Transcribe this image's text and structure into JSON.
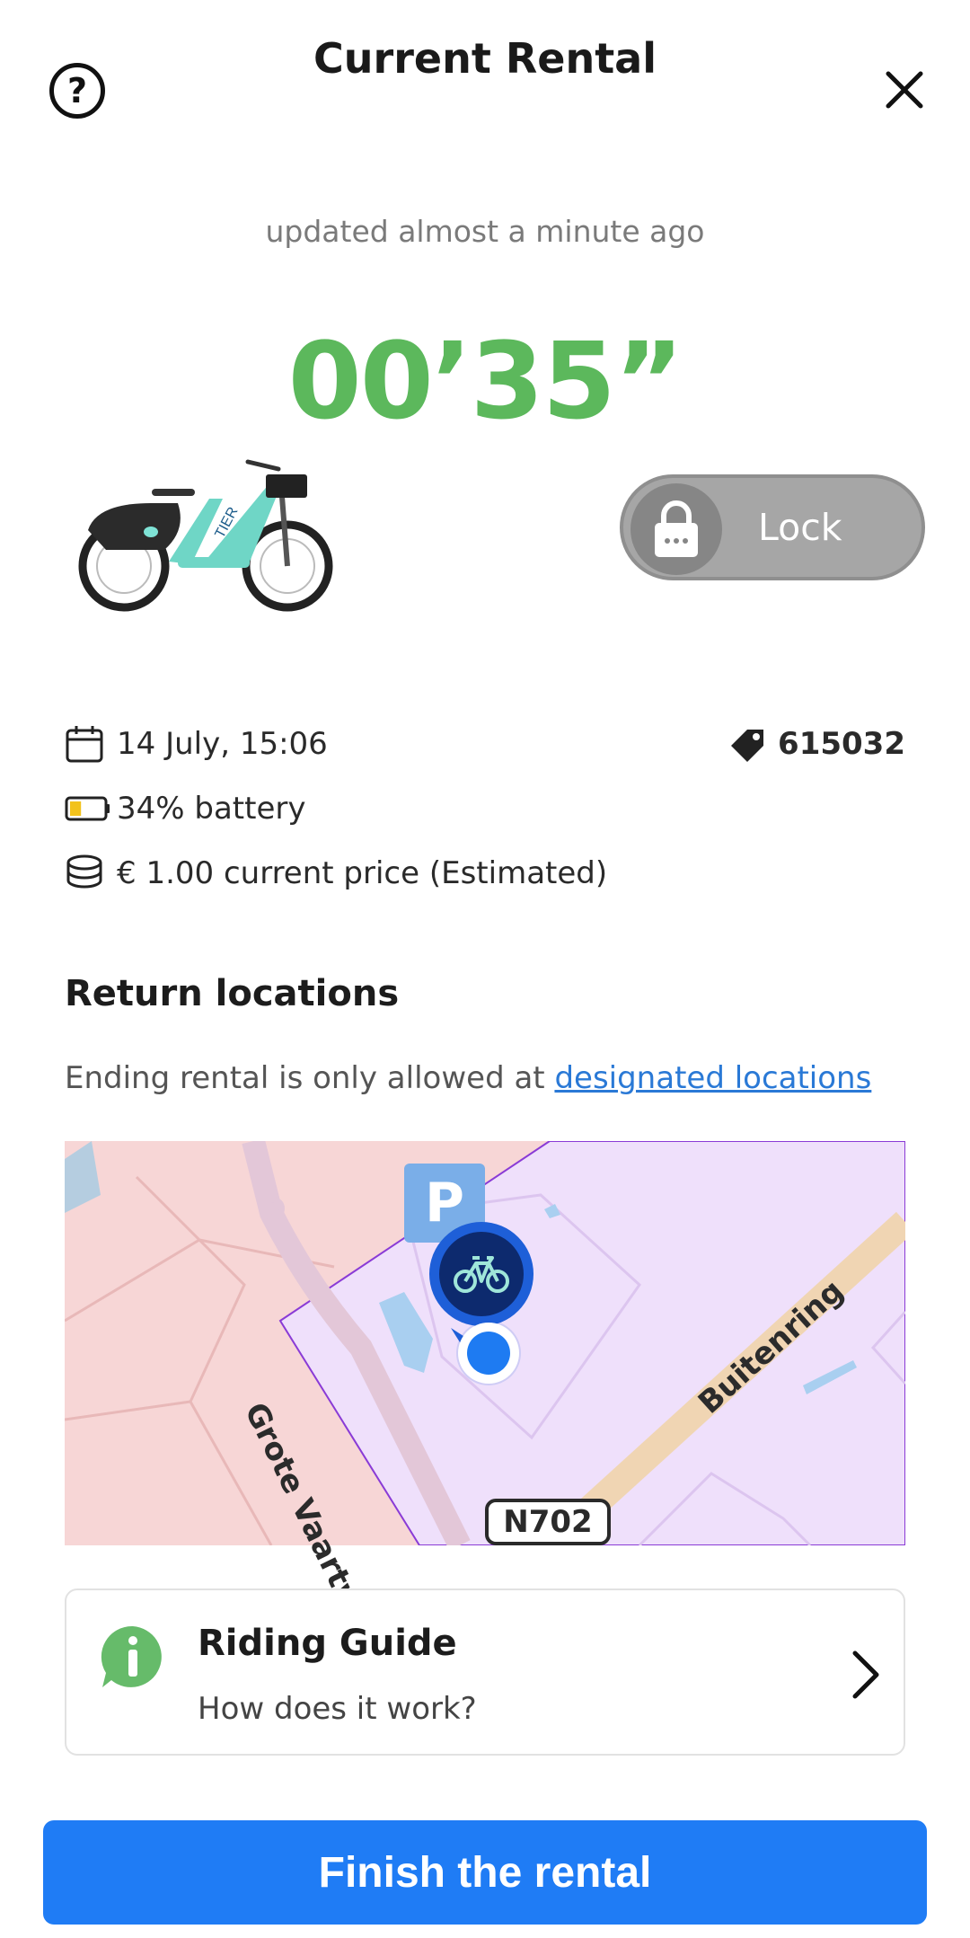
{
  "header": {
    "title": "Current Rental",
    "help_icon": "question-circle-icon",
    "close_icon": "close-icon"
  },
  "status": {
    "updated_text": "updated almost a minute ago",
    "timer": "00’35”"
  },
  "lock": {
    "label": "Lock",
    "icon": "padlock-icon"
  },
  "details": {
    "date": "14 July, 15:06",
    "battery": "34% battery",
    "battery_level_percent": 34,
    "price": "€ 1.00 current price (Estimated)",
    "vehicle_id": "615032"
  },
  "return_locations": {
    "title": "Return locations",
    "description_prefix": "Ending rental is only allowed at ",
    "link_text": "designated locations",
    "map": {
      "street_1": "Grote Vaartweg",
      "street_2": "Buitenring",
      "road_shield": "N702",
      "parking_letter": "P"
    }
  },
  "guide": {
    "title": "Riding Guide",
    "subtitle": "How does it work?"
  },
  "actions": {
    "finish_label": "Finish the rental"
  },
  "colors": {
    "timer_green": "#5cb85c",
    "primary_blue": "#1f7cf5",
    "link_blue": "#2a79d6",
    "map_zone_purple": "#efe0fb",
    "map_area_pink": "#f7d6d6"
  }
}
